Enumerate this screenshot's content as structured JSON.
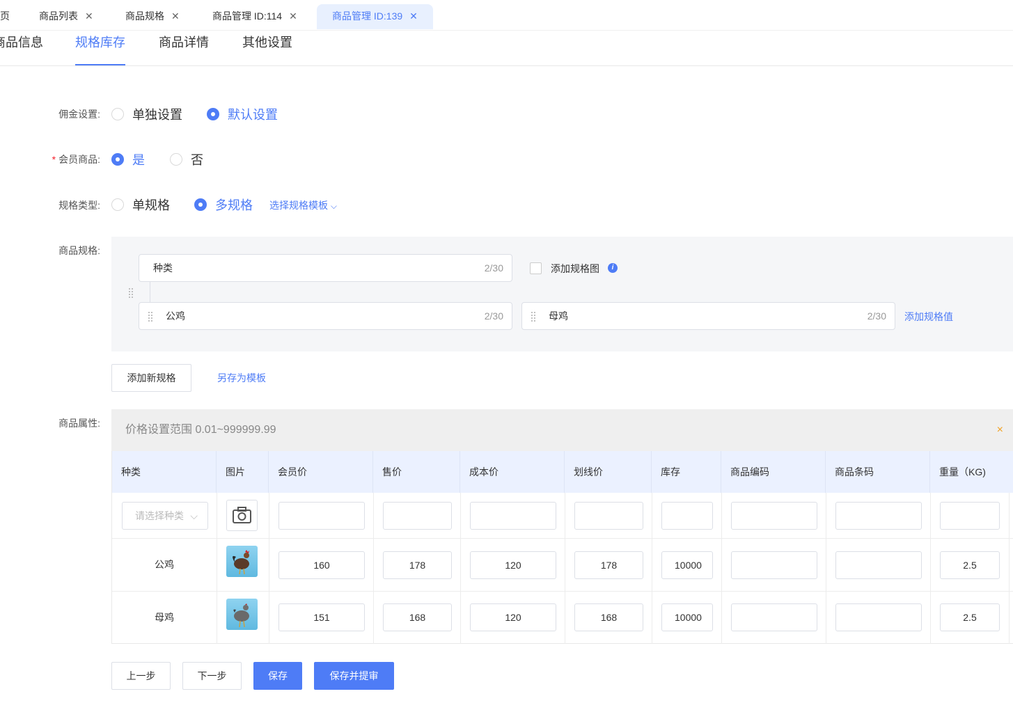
{
  "tabs": [
    {
      "label": "页",
      "active": false,
      "closable": false
    },
    {
      "label": "商品列表",
      "active": false,
      "closable": true
    },
    {
      "label": "商品规格",
      "active": false,
      "closable": true
    },
    {
      "label": "商品管理 ID:114",
      "active": false,
      "closable": true
    },
    {
      "label": "商品管理 ID:139",
      "active": true,
      "closable": true
    }
  ],
  "subtabs": [
    "商品信息",
    "规格库存",
    "商品详情",
    "其他设置"
  ],
  "form": {
    "commission": {
      "label": "佣金设置:",
      "options": [
        "单独设置",
        "默认设置"
      ],
      "selected": "默认设置"
    },
    "member": {
      "label": "会员商品:",
      "required_mark": "*",
      "options": [
        "是",
        "否"
      ],
      "selected": "是"
    },
    "spec_type": {
      "label": "规格类型:",
      "options": [
        "单规格",
        "多规格"
      ],
      "selected": "多规格",
      "template_link": "选择规格模板"
    },
    "spec": {
      "label": "商品规格:",
      "name": "种类",
      "name_count": "2/30",
      "add_image_label": "添加规格图",
      "values": [
        {
          "value": "公鸡",
          "count": "2/30"
        },
        {
          "value": "母鸡",
          "count": "2/30"
        }
      ],
      "add_value_link": "添加规格值"
    },
    "add_spec_button": "添加新规格",
    "save_template_link": "另存为模板",
    "attr_label": "商品属性:",
    "price_alert": "价格设置范围 0.01~999999.99",
    "close_glyph": "×"
  },
  "table": {
    "headers": [
      "种类",
      "图片",
      "会员价",
      "售价",
      "成本价",
      "划线价",
      "库存",
      "商品编码",
      "商品条码",
      "重量（KG)"
    ],
    "batch_select_placeholder": "请选择种类",
    "rows": [
      {
        "name": "公鸡",
        "member_price": "160",
        "price": "178",
        "cost": "120",
        "line_price": "178",
        "stock": "10000",
        "code": "",
        "barcode": "",
        "weight": "2.5"
      },
      {
        "name": "母鸡",
        "member_price": "151",
        "price": "168",
        "cost": "120",
        "line_price": "168",
        "stock": "10000",
        "code": "",
        "barcode": "",
        "weight": "2.5"
      }
    ]
  },
  "footer": {
    "prev": "上一步",
    "next": "下一步",
    "save": "保存",
    "save_submit": "保存并提审"
  },
  "colors": {
    "primary": "#4e7cf6",
    "alert_close": "#f0a020",
    "required": "#f5222d"
  }
}
